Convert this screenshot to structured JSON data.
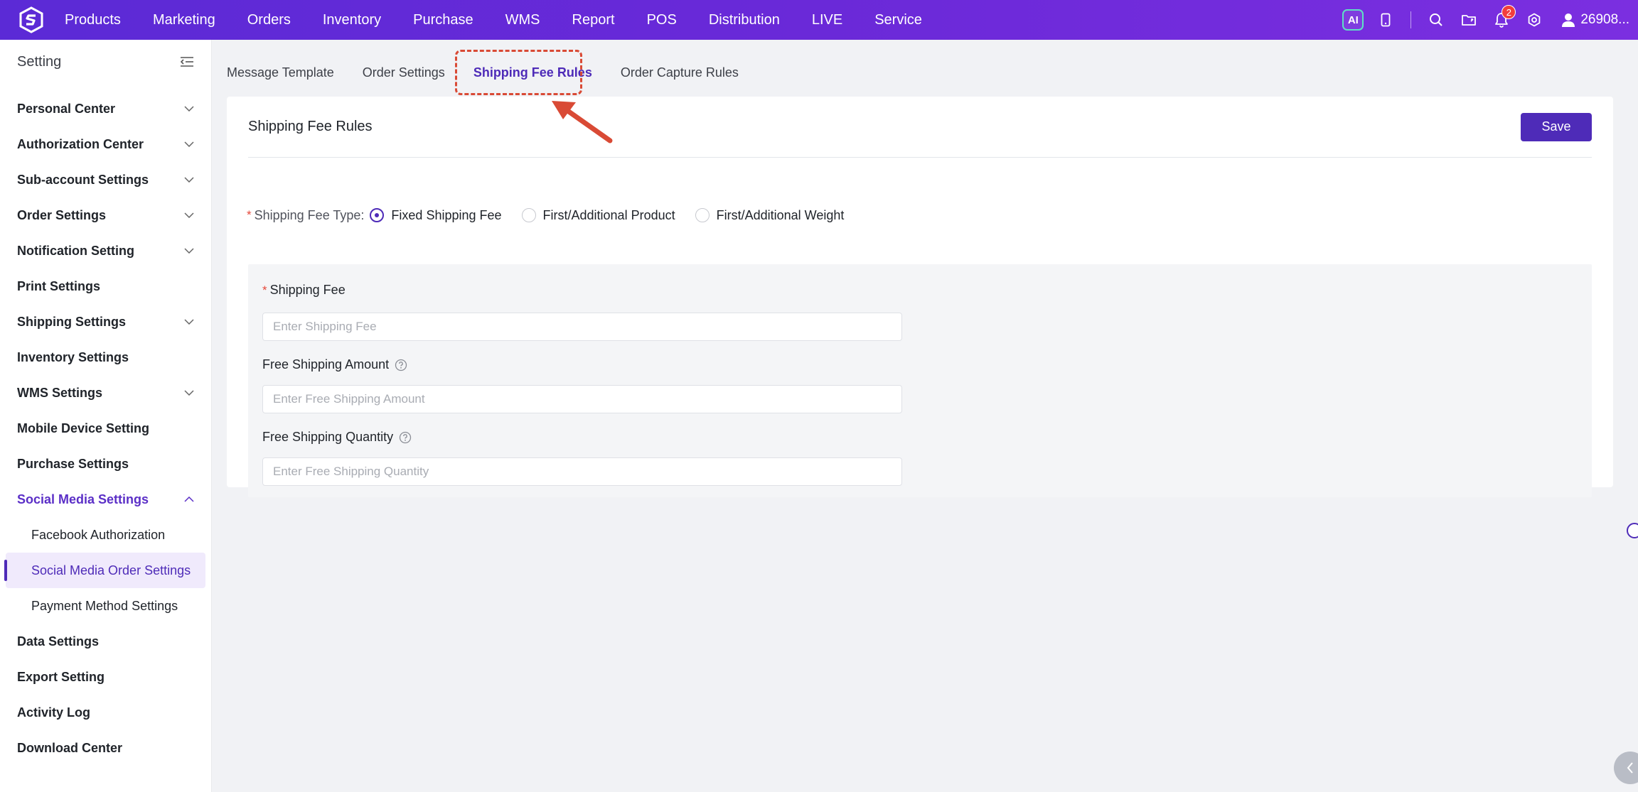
{
  "brand": {
    "accent": "#4e2bb8",
    "topbar": "#6a29d8",
    "required": "#e5483a"
  },
  "topnav": {
    "items": [
      "Products",
      "Marketing",
      "Orders",
      "Inventory",
      "Purchase",
      "WMS",
      "Report",
      "POS",
      "Distribution",
      "LIVE",
      "Service"
    ],
    "ai_label": "AI",
    "notification_count": "2",
    "user_label": "26908..."
  },
  "sidebar": {
    "title": "Setting",
    "items": [
      {
        "label": "Personal Center",
        "chevron": "down"
      },
      {
        "label": "Authorization Center",
        "chevron": "down"
      },
      {
        "label": "Sub-account Settings",
        "chevron": "down"
      },
      {
        "label": "Order Settings",
        "chevron": "down"
      },
      {
        "label": "Notification Setting",
        "chevron": "down"
      },
      {
        "label": "Print Settings",
        "chevron": ""
      },
      {
        "label": "Shipping Settings",
        "chevron": "down"
      },
      {
        "label": "Inventory Settings",
        "chevron": ""
      },
      {
        "label": "WMS Settings",
        "chevron": "down"
      },
      {
        "label": "Mobile Device Setting",
        "chevron": ""
      },
      {
        "label": "Purchase Settings",
        "chevron": ""
      },
      {
        "label": "Social Media Settings",
        "chevron": "up"
      }
    ],
    "subitems": [
      "Facebook Authorization",
      "Social Media Order Settings",
      "Payment Method Settings"
    ],
    "items_after": [
      "Data Settings",
      "Export Setting",
      "Activity Log",
      "Download Center"
    ]
  },
  "tabs": [
    "Message Template",
    "Order Settings",
    "Shipping Fee Rules",
    "Order Capture Rules"
  ],
  "card": {
    "title": "Shipping Fee Rules",
    "save_label": "Save",
    "type_label": "Shipping Fee Type",
    "type_colon": ":",
    "options": [
      "Fixed Shipping Fee",
      "First/Additional Product",
      "First/Additional Weight"
    ],
    "selected_option": "Fixed Shipping Fee"
  },
  "fields": {
    "shipping_fee_label": "Shipping Fee",
    "shipping_fee_placeholder": "Enter Shipping Fee",
    "free_amount_label": "Free Shipping Amount",
    "free_amount_placeholder": "Enter Free Shipping Amount",
    "free_qty_label": "Free Shipping Quantity",
    "free_qty_placeholder": "Enter Free Shipping Quantity"
  }
}
